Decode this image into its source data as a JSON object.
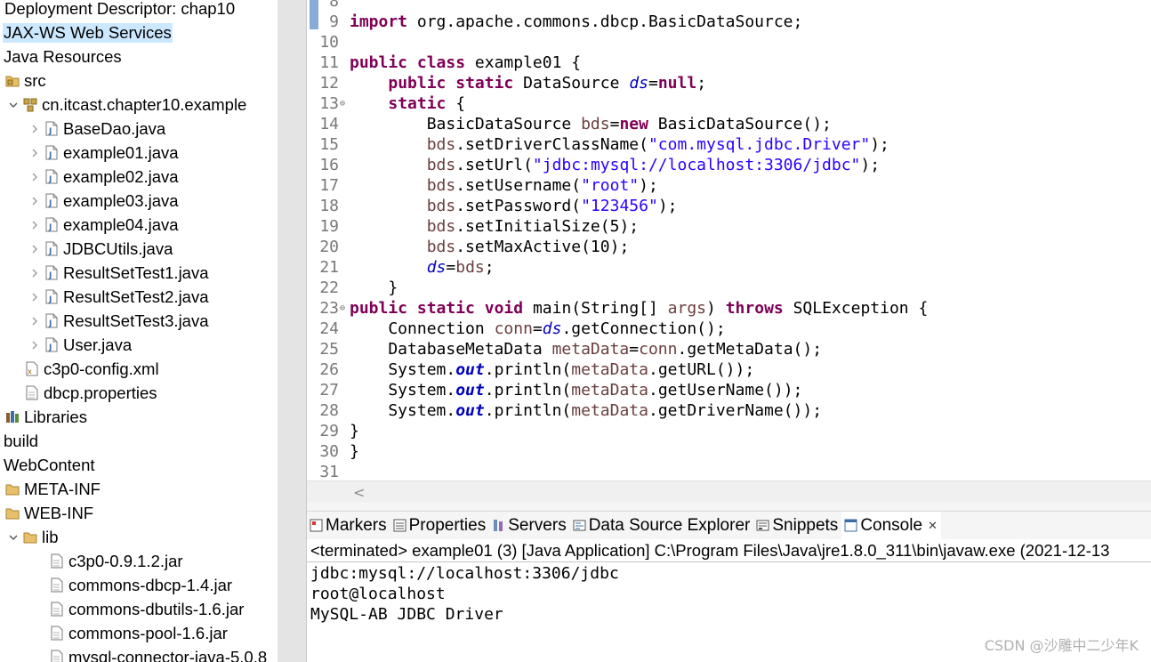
{
  "explorer": {
    "items": [
      {
        "label": "Deployment Descriptor: chap10",
        "icon": "none",
        "chevron": "none"
      },
      {
        "label": "JAX-WS Web Services",
        "icon": "none",
        "chevron": "none",
        "selected": true
      },
      {
        "label": "Java Resources",
        "icon": "none",
        "chevron": "none"
      },
      {
        "label": "src",
        "icon": "source-folder-icon",
        "chevron": "none"
      },
      {
        "label": "cn.itcast.chapter10.example",
        "icon": "package-icon",
        "chevron": "expanded"
      },
      {
        "label": "BaseDao.java",
        "icon": "java-file-icon",
        "chevron": "collapsed"
      },
      {
        "label": "example01.java",
        "icon": "java-file-icon",
        "chevron": "collapsed"
      },
      {
        "label": "example02.java",
        "icon": "java-file-icon",
        "chevron": "collapsed"
      },
      {
        "label": "example03.java",
        "icon": "java-file-icon",
        "chevron": "collapsed"
      },
      {
        "label": "example04.java",
        "icon": "java-file-icon",
        "chevron": "collapsed"
      },
      {
        "label": "JDBCUtils.java",
        "icon": "java-file-icon",
        "chevron": "collapsed"
      },
      {
        "label": "ResultSetTest1.java",
        "icon": "java-file-icon",
        "chevron": "collapsed"
      },
      {
        "label": "ResultSetTest2.java",
        "icon": "java-file-icon",
        "chevron": "collapsed"
      },
      {
        "label": "ResultSetTest3.java",
        "icon": "java-file-icon",
        "chevron": "collapsed"
      },
      {
        "label": "User.java",
        "icon": "java-file-icon",
        "chevron": "collapsed"
      },
      {
        "label": "c3p0-config.xml",
        "icon": "xml-file-icon",
        "chevron": "none"
      },
      {
        "label": "dbcp.properties",
        "icon": "text-file-icon",
        "chevron": "none"
      },
      {
        "label": "Libraries",
        "icon": "library-icon",
        "chevron": "none"
      },
      {
        "label": "build",
        "icon": "none",
        "chevron": "none"
      },
      {
        "label": "WebContent",
        "icon": "none",
        "chevron": "none"
      },
      {
        "label": "META-INF",
        "icon": "folder-icon",
        "chevron": "none"
      },
      {
        "label": "WEB-INF",
        "icon": "folder-icon",
        "chevron": "none"
      },
      {
        "label": "lib",
        "icon": "folder-icon",
        "chevron": "expanded"
      },
      {
        "label": "c3p0-0.9.1.2.jar",
        "icon": "jar-file-icon",
        "chevron": "none"
      },
      {
        "label": "commons-dbcp-1.4.jar",
        "icon": "jar-file-icon",
        "chevron": "none"
      },
      {
        "label": "commons-dbutils-1.6.jar",
        "icon": "jar-file-icon",
        "chevron": "none"
      },
      {
        "label": "commons-pool-1.6.jar",
        "icon": "jar-file-icon",
        "chevron": "none"
      },
      {
        "label": "mysql-connector-java-5.0.8",
        "icon": "jar-file-icon",
        "chevron": "none"
      }
    ]
  },
  "editor": {
    "lines": [
      {
        "num": "8",
        "fold": "",
        "tokens": []
      },
      {
        "num": "9",
        "fold": "",
        "tokens": [
          {
            "t": "import",
            "c": "kw"
          },
          {
            "t": " org.apache.commons.dbcp.BasicDataSource;",
            "c": ""
          }
        ]
      },
      {
        "num": "10",
        "fold": "",
        "tokens": []
      },
      {
        "num": "11",
        "fold": "",
        "tokens": [
          {
            "t": "public",
            "c": "kw"
          },
          {
            "t": " ",
            "c": ""
          },
          {
            "t": "class",
            "c": "kw"
          },
          {
            "t": " example01 {",
            "c": ""
          }
        ]
      },
      {
        "num": "12",
        "fold": "",
        "tokens": [
          {
            "t": "    ",
            "c": ""
          },
          {
            "t": "public",
            "c": "kw"
          },
          {
            "t": " ",
            "c": ""
          },
          {
            "t": "static",
            "c": "kw"
          },
          {
            "t": " DataSource ",
            "c": ""
          },
          {
            "t": "ds",
            "c": "fld"
          },
          {
            "t": "=",
            "c": ""
          },
          {
            "t": "null",
            "c": "kw"
          },
          {
            "t": ";",
            "c": ""
          }
        ]
      },
      {
        "num": "13",
        "fold": "⊖",
        "tokens": [
          {
            "t": "    ",
            "c": ""
          },
          {
            "t": "static",
            "c": "kw"
          },
          {
            "t": " {",
            "c": ""
          }
        ]
      },
      {
        "num": "14",
        "fold": "",
        "tokens": [
          {
            "t": "        BasicDataSource ",
            "c": ""
          },
          {
            "t": "bds",
            "c": "var"
          },
          {
            "t": "=",
            "c": ""
          },
          {
            "t": "new",
            "c": "kw"
          },
          {
            "t": " BasicDataSource();",
            "c": ""
          }
        ]
      },
      {
        "num": "15",
        "fold": "",
        "tokens": [
          {
            "t": "        ",
            "c": ""
          },
          {
            "t": "bds",
            "c": "var"
          },
          {
            "t": ".setDriverClassName(",
            "c": ""
          },
          {
            "t": "\"com.mysql.jdbc.Driver\"",
            "c": "str"
          },
          {
            "t": ");",
            "c": ""
          }
        ]
      },
      {
        "num": "16",
        "fold": "",
        "tokens": [
          {
            "t": "        ",
            "c": ""
          },
          {
            "t": "bds",
            "c": "var"
          },
          {
            "t": ".setUrl(",
            "c": ""
          },
          {
            "t": "\"jdbc:mysql://localhost:3306/jdbc\"",
            "c": "str"
          },
          {
            "t": ");",
            "c": ""
          }
        ]
      },
      {
        "num": "17",
        "fold": "",
        "tokens": [
          {
            "t": "        ",
            "c": ""
          },
          {
            "t": "bds",
            "c": "var"
          },
          {
            "t": ".setUsername(",
            "c": ""
          },
          {
            "t": "\"root\"",
            "c": "str"
          },
          {
            "t": ");",
            "c": ""
          }
        ]
      },
      {
        "num": "18",
        "fold": "",
        "tokens": [
          {
            "t": "        ",
            "c": ""
          },
          {
            "t": "bds",
            "c": "var"
          },
          {
            "t": ".setPassword(",
            "c": ""
          },
          {
            "t": "\"123456\"",
            "c": "str"
          },
          {
            "t": ");",
            "c": ""
          }
        ]
      },
      {
        "num": "19",
        "fold": "",
        "tokens": [
          {
            "t": "        ",
            "c": ""
          },
          {
            "t": "bds",
            "c": "var"
          },
          {
            "t": ".setInitialSize(5);",
            "c": ""
          }
        ]
      },
      {
        "num": "20",
        "fold": "",
        "tokens": [
          {
            "t": "        ",
            "c": ""
          },
          {
            "t": "bds",
            "c": "var"
          },
          {
            "t": ".setMaxActive(10);",
            "c": ""
          }
        ]
      },
      {
        "num": "21",
        "fold": "",
        "tokens": [
          {
            "t": "        ",
            "c": ""
          },
          {
            "t": "ds",
            "c": "fld"
          },
          {
            "t": "=",
            "c": ""
          },
          {
            "t": "bds",
            "c": "var"
          },
          {
            "t": ";",
            "c": ""
          }
        ]
      },
      {
        "num": "22",
        "fold": "",
        "tokens": [
          {
            "t": "    }",
            "c": ""
          }
        ]
      },
      {
        "num": "23",
        "fold": "⊖",
        "tokens": [
          {
            "t": "public",
            "c": "kw"
          },
          {
            "t": " ",
            "c": ""
          },
          {
            "t": "static",
            "c": "kw"
          },
          {
            "t": " ",
            "c": ""
          },
          {
            "t": "void",
            "c": "kw"
          },
          {
            "t": " main(String[] ",
            "c": ""
          },
          {
            "t": "args",
            "c": "var"
          },
          {
            "t": ") ",
            "c": ""
          },
          {
            "t": "throws",
            "c": "kw"
          },
          {
            "t": " SQLException {",
            "c": ""
          }
        ]
      },
      {
        "num": "24",
        "fold": "",
        "tokens": [
          {
            "t": "    Connection ",
            "c": ""
          },
          {
            "t": "conn",
            "c": "var"
          },
          {
            "t": "=",
            "c": ""
          },
          {
            "t": "ds",
            "c": "fld"
          },
          {
            "t": ".getConnection();",
            "c": ""
          }
        ]
      },
      {
        "num": "25",
        "fold": "",
        "tokens": [
          {
            "t": "    DatabaseMetaData ",
            "c": ""
          },
          {
            "t": "metaData",
            "c": "var"
          },
          {
            "t": "=",
            "c": ""
          },
          {
            "t": "conn",
            "c": "var"
          },
          {
            "t": ".getMetaData();",
            "c": ""
          }
        ]
      },
      {
        "num": "26",
        "fold": "",
        "tokens": [
          {
            "t": "    System.",
            "c": ""
          },
          {
            "t": "out",
            "c": "sfld"
          },
          {
            "t": ".println(",
            "c": ""
          },
          {
            "t": "metaData",
            "c": "var"
          },
          {
            "t": ".getURL());",
            "c": ""
          }
        ]
      },
      {
        "num": "27",
        "fold": "",
        "tokens": [
          {
            "t": "    System.",
            "c": ""
          },
          {
            "t": "out",
            "c": "sfld"
          },
          {
            "t": ".println(",
            "c": ""
          },
          {
            "t": "metaData",
            "c": "var"
          },
          {
            "t": ".getUserName());",
            "c": ""
          }
        ]
      },
      {
        "num": "28",
        "fold": "",
        "tokens": [
          {
            "t": "    System.",
            "c": ""
          },
          {
            "t": "out",
            "c": "sfld"
          },
          {
            "t": ".println(",
            "c": ""
          },
          {
            "t": "metaData",
            "c": "var"
          },
          {
            "t": ".getDriverName());",
            "c": ""
          }
        ]
      },
      {
        "num": "29",
        "fold": "",
        "tokens": [
          {
            "t": "}",
            "c": ""
          }
        ]
      },
      {
        "num": "30",
        "fold": "",
        "tokens": [
          {
            "t": "}",
            "c": ""
          }
        ]
      },
      {
        "num": "31",
        "fold": "",
        "tokens": []
      }
    ],
    "scroll_left_glyph": "<"
  },
  "views": {
    "tabs": [
      {
        "label": "Markers",
        "icon": "markers-icon"
      },
      {
        "label": "Properties",
        "icon": "properties-icon"
      },
      {
        "label": "Servers",
        "icon": "servers-icon"
      },
      {
        "label": "Data Source Explorer",
        "icon": "data-source-explorer-icon"
      },
      {
        "label": "Snippets",
        "icon": "snippets-icon"
      },
      {
        "label": "Console",
        "icon": "console-icon",
        "active": true,
        "close": "✕"
      }
    ]
  },
  "console": {
    "status": "<terminated> example01 (3) [Java Application] C:\\Program Files\\Java\\jre1.8.0_311\\bin\\javaw.exe  (2021-12-13",
    "output": [
      "jdbc:mysql://localhost:3306/jdbc",
      "root@localhost",
      "MySQL-AB JDBC Driver"
    ]
  },
  "watermark": "CSDN @沙雕中二少年K",
  "colors": {
    "keyword": "#7f0055",
    "string": "#2a00ff",
    "field": "#0000c0",
    "local_variable": "#6a3e3e",
    "line_number": "#787878",
    "selection": "#cce8ff"
  }
}
